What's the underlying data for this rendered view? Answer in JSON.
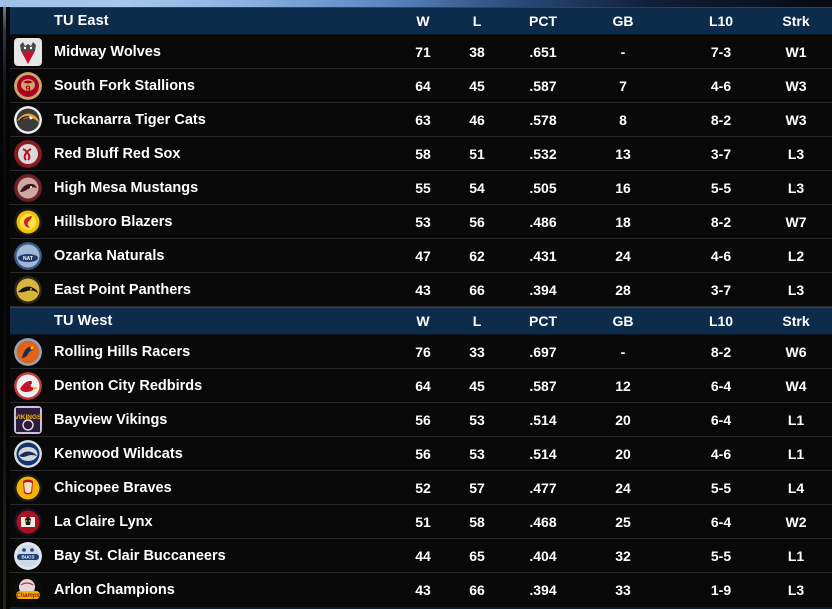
{
  "columns": {
    "team": "",
    "w": "W",
    "l": "L",
    "pct": "PCT",
    "gb": "GB",
    "l10": "L10",
    "strk": "Strk"
  },
  "colors": {
    "header_bg": "#0d2b4a",
    "row_bg": "#090909",
    "row_divider": "#2a2a2a",
    "text": "#ffffff"
  },
  "divisions": [
    {
      "name": "TU East",
      "teams": [
        {
          "logo": "midway-wolves-logo",
          "name": "Midway Wolves",
          "w": "71",
          "l": "38",
          "pct": ".651",
          "gb": "-",
          "l10": "7-3",
          "strk": "W1"
        },
        {
          "logo": "south-fork-stallions-logo",
          "name": "South Fork Stallions",
          "w": "64",
          "l": "45",
          "pct": ".587",
          "gb": "7",
          "l10": "4-6",
          "strk": "W3"
        },
        {
          "logo": "tuckanarra-tiger-cats-logo",
          "name": "Tuckanarra Tiger Cats",
          "w": "63",
          "l": "46",
          "pct": ".578",
          "gb": "8",
          "l10": "8-2",
          "strk": "W3"
        },
        {
          "logo": "red-bluff-red-sox-logo",
          "name": "Red Bluff Red Sox",
          "w": "58",
          "l": "51",
          "pct": ".532",
          "gb": "13",
          "l10": "3-7",
          "strk": "L3"
        },
        {
          "logo": "high-mesa-mustangs-logo",
          "name": "High Mesa Mustangs",
          "w": "55",
          "l": "54",
          "pct": ".505",
          "gb": "16",
          "l10": "5-5",
          "strk": "L3"
        },
        {
          "logo": "hillsboro-blazers-logo",
          "name": "Hillsboro Blazers",
          "w": "53",
          "l": "56",
          "pct": ".486",
          "gb": "18",
          "l10": "8-2",
          "strk": "W7"
        },
        {
          "logo": "ozarka-naturals-logo",
          "name": "Ozarka Naturals",
          "w": "47",
          "l": "62",
          "pct": ".431",
          "gb": "24",
          "l10": "4-6",
          "strk": "L2"
        },
        {
          "logo": "east-point-panthers-logo",
          "name": "East Point Panthers",
          "w": "43",
          "l": "66",
          "pct": ".394",
          "gb": "28",
          "l10": "3-7",
          "strk": "L3"
        }
      ]
    },
    {
      "name": "TU West",
      "teams": [
        {
          "logo": "rolling-hills-racers-logo",
          "name": "Rolling Hills Racers",
          "w": "76",
          "l": "33",
          "pct": ".697",
          "gb": "-",
          "l10": "8-2",
          "strk": "W6"
        },
        {
          "logo": "denton-city-redbirds-logo",
          "name": "Denton City Redbirds",
          "w": "64",
          "l": "45",
          "pct": ".587",
          "gb": "12",
          "l10": "6-4",
          "strk": "W4"
        },
        {
          "logo": "bayview-vikings-logo",
          "name": "Bayview Vikings",
          "w": "56",
          "l": "53",
          "pct": ".514",
          "gb": "20",
          "l10": "6-4",
          "strk": "L1"
        },
        {
          "logo": "kenwood-wildcats-logo",
          "name": "Kenwood Wildcats",
          "w": "56",
          "l": "53",
          "pct": ".514",
          "gb": "20",
          "l10": "4-6",
          "strk": "L1"
        },
        {
          "logo": "chicopee-braves-logo",
          "name": "Chicopee Braves",
          "w": "52",
          "l": "57",
          "pct": ".477",
          "gb": "24",
          "l10": "5-5",
          "strk": "L4"
        },
        {
          "logo": "la-claire-lynx-logo",
          "name": "La Claire Lynx",
          "w": "51",
          "l": "58",
          "pct": ".468",
          "gb": "25",
          "l10": "6-4",
          "strk": "W2"
        },
        {
          "logo": "bay-st-clair-buccaneers-logo",
          "name": "Bay St. Clair Buccaneers",
          "w": "44",
          "l": "65",
          "pct": ".404",
          "gb": "32",
          "l10": "5-5",
          "strk": "L1"
        },
        {
          "logo": "arlon-champions-logo",
          "name": "Arlon Champions",
          "w": "43",
          "l": "66",
          "pct": ".394",
          "gb": "33",
          "l10": "1-9",
          "strk": "L3"
        }
      ]
    }
  ]
}
